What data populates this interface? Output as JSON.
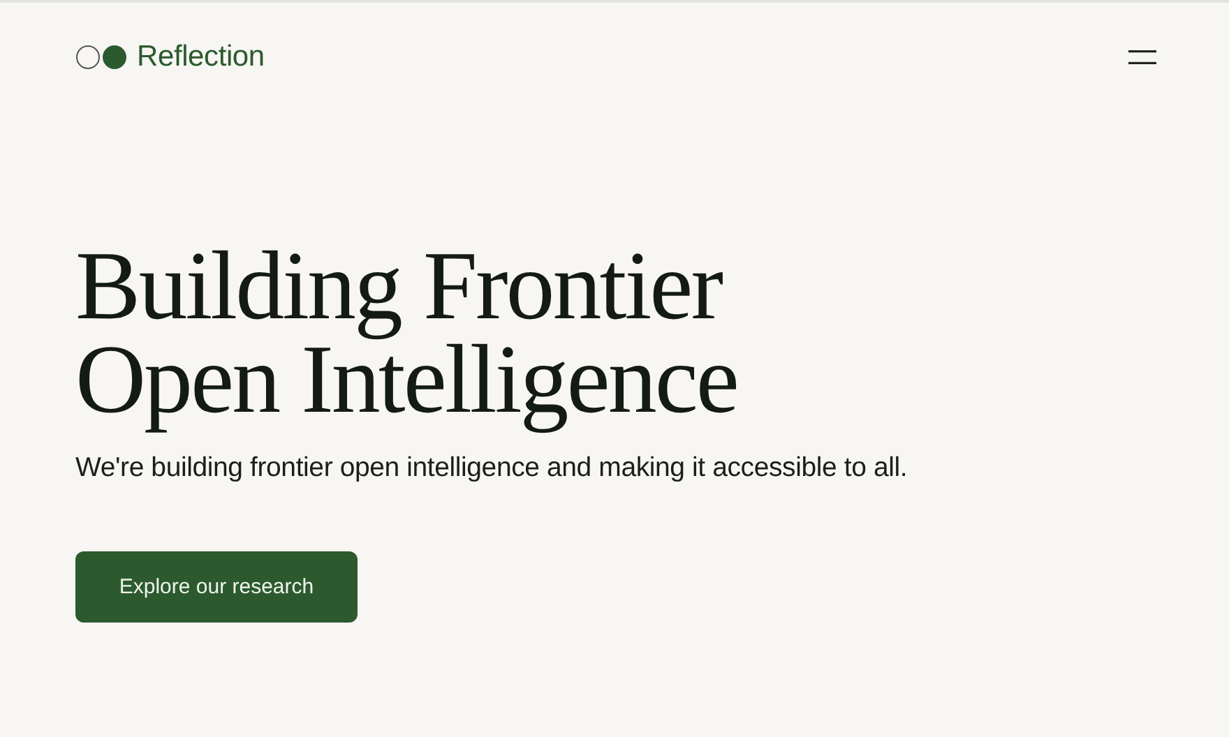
{
  "header": {
    "logo": "Reflection"
  },
  "hero": {
    "title_lines": [
      "Building Frontier",
      "Open Intelligence"
    ],
    "subtitle": "We're building frontier open intelligence and making it accessible to all.",
    "button": "Explore our research"
  }
}
